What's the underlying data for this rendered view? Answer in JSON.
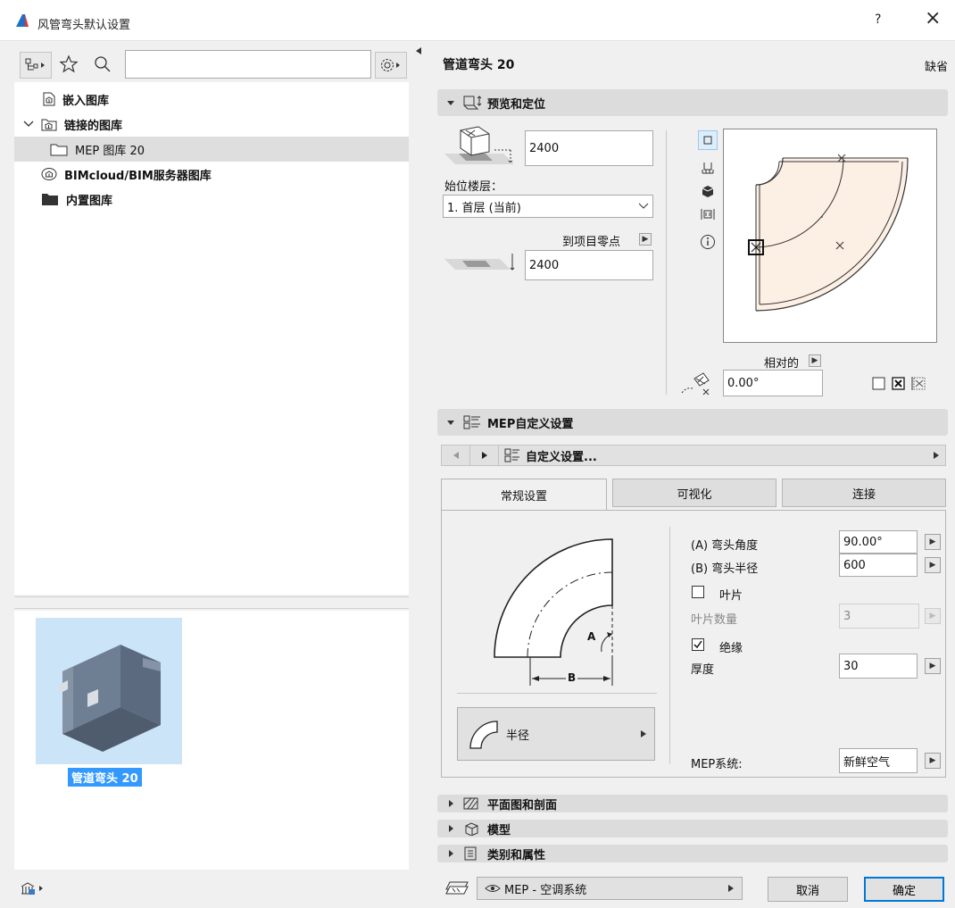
{
  "window": {
    "title": "风管弯头默认设置",
    "help_label": "?",
    "close_label": "×"
  },
  "left": {
    "search_placeholder": "",
    "tree": [
      {
        "label": "嵌入图库",
        "bold": true
      },
      {
        "label": "链接的图库",
        "bold": true
      },
      {
        "label": "MEP 图库 20",
        "bold": false
      },
      {
        "label": "BIMcloud/BIM服务器图库",
        "bold": true
      },
      {
        "label": "内置图库",
        "bold": true
      }
    ],
    "preview_caption": "管道弯头 20"
  },
  "right": {
    "object_title": "管道弯头 20",
    "default_label": "缺省",
    "sections": {
      "preview": "预览和定位",
      "mep_custom": "MEP自定义设置",
      "plan_section": "平面图和剖面",
      "model": "模型",
      "category": "类别和属性"
    },
    "positioning": {
      "height_value": "2400",
      "home_story_label": "始位楼层：",
      "home_story_value": "1. 首层 (当前)",
      "to_project_zero_label": "到项目零点",
      "elevation_value": "2400",
      "relative_label": "相对的",
      "angle_value": "0.00°"
    },
    "custom_settings_label": "自定义设置...",
    "tabs": [
      "常规设置",
      "可视化",
      "连接"
    ],
    "params": {
      "angle_label": "(A) 弯头角度",
      "angle_value": "90.00°",
      "radius_label": "(B) 弯头半径",
      "radius_value": "600",
      "vanes_label": "叶片",
      "vane_count_label": "叶片数量",
      "vane_count_value": "3",
      "insulation_label": "绝缘",
      "thickness_label": "厚度",
      "thickness_value": "30",
      "mep_system_label": "MEP系统:",
      "mep_system_value": "新鲜空气"
    },
    "diagram": {
      "label_a": "A",
      "label_b": "B"
    },
    "shape_button_label": "半径"
  },
  "footer": {
    "layer_value": "MEP - 空调系统",
    "cancel_label": "取消",
    "ok_label": "确定"
  },
  "colors": {
    "accent": "#0078d7",
    "preview_fill": "#fcefe4",
    "selection_bg": "#cce4f7",
    "caption_bg": "#3399ff"
  }
}
